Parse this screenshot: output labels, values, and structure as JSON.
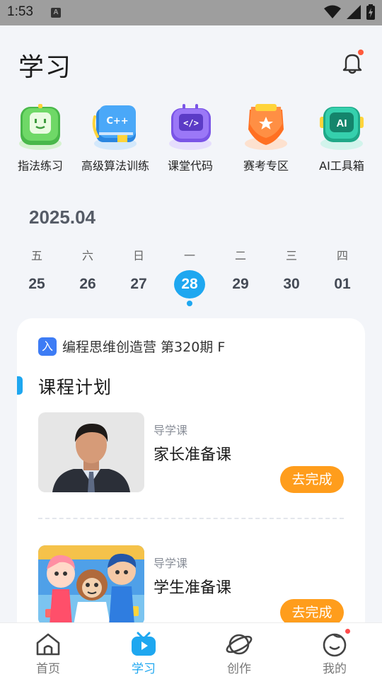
{
  "status_bar": {
    "time": "1:53",
    "sim_icon": "A"
  },
  "header": {
    "title": "学习"
  },
  "quick_entries": [
    {
      "label": "指法练习",
      "icon": "keyboard-face-icon",
      "color": "#5ccf55"
    },
    {
      "label": "高级算法训练",
      "icon": "c++-book-icon",
      "color": "#3a9ef5"
    },
    {
      "label": "课堂代码",
      "icon": "code-monitor-icon",
      "color": "#8a62f0"
    },
    {
      "label": "赛考专区",
      "icon": "trophy-star-icon",
      "color": "#ff7a2e"
    },
    {
      "label": "AI工具箱",
      "icon": "ai-robot-icon",
      "color": "#2cc9a8"
    }
  ],
  "calendar": {
    "month": "2025.04",
    "days": [
      {
        "weekday": "五",
        "date": "25",
        "active": false
      },
      {
        "weekday": "六",
        "date": "26",
        "active": false
      },
      {
        "weekday": "日",
        "date": "27",
        "active": false
      },
      {
        "weekday": "一",
        "date": "28",
        "active": true
      },
      {
        "weekday": "二",
        "date": "29",
        "active": false
      },
      {
        "weekday": "三",
        "date": "30",
        "active": false
      },
      {
        "weekday": "四",
        "date": "01",
        "active": false
      }
    ]
  },
  "course_card": {
    "tag": "入",
    "camp_name": "编程思维创造营 第320期 F",
    "section_title": "课程计划",
    "lessons": [
      {
        "type": "导学课",
        "title": "家长准备课",
        "action": "去完成",
        "thumb": "teacher-portrait"
      },
      {
        "type": "导学课",
        "title": "学生准备课",
        "action": "去完成",
        "thumb": "cartoon-characters"
      }
    ]
  },
  "bottom_nav": {
    "items": [
      {
        "label": "首页",
        "icon": "home-icon",
        "active": false
      },
      {
        "label": "学习",
        "icon": "tv-play-icon",
        "active": true
      },
      {
        "label": "创作",
        "icon": "planet-icon",
        "active": false
      },
      {
        "label": "我的",
        "icon": "smile-face-icon",
        "active": false
      }
    ]
  },
  "colors": {
    "accent": "#1ea7f0",
    "action": "#ff9d1c",
    "badge": "#ff5a3c"
  }
}
